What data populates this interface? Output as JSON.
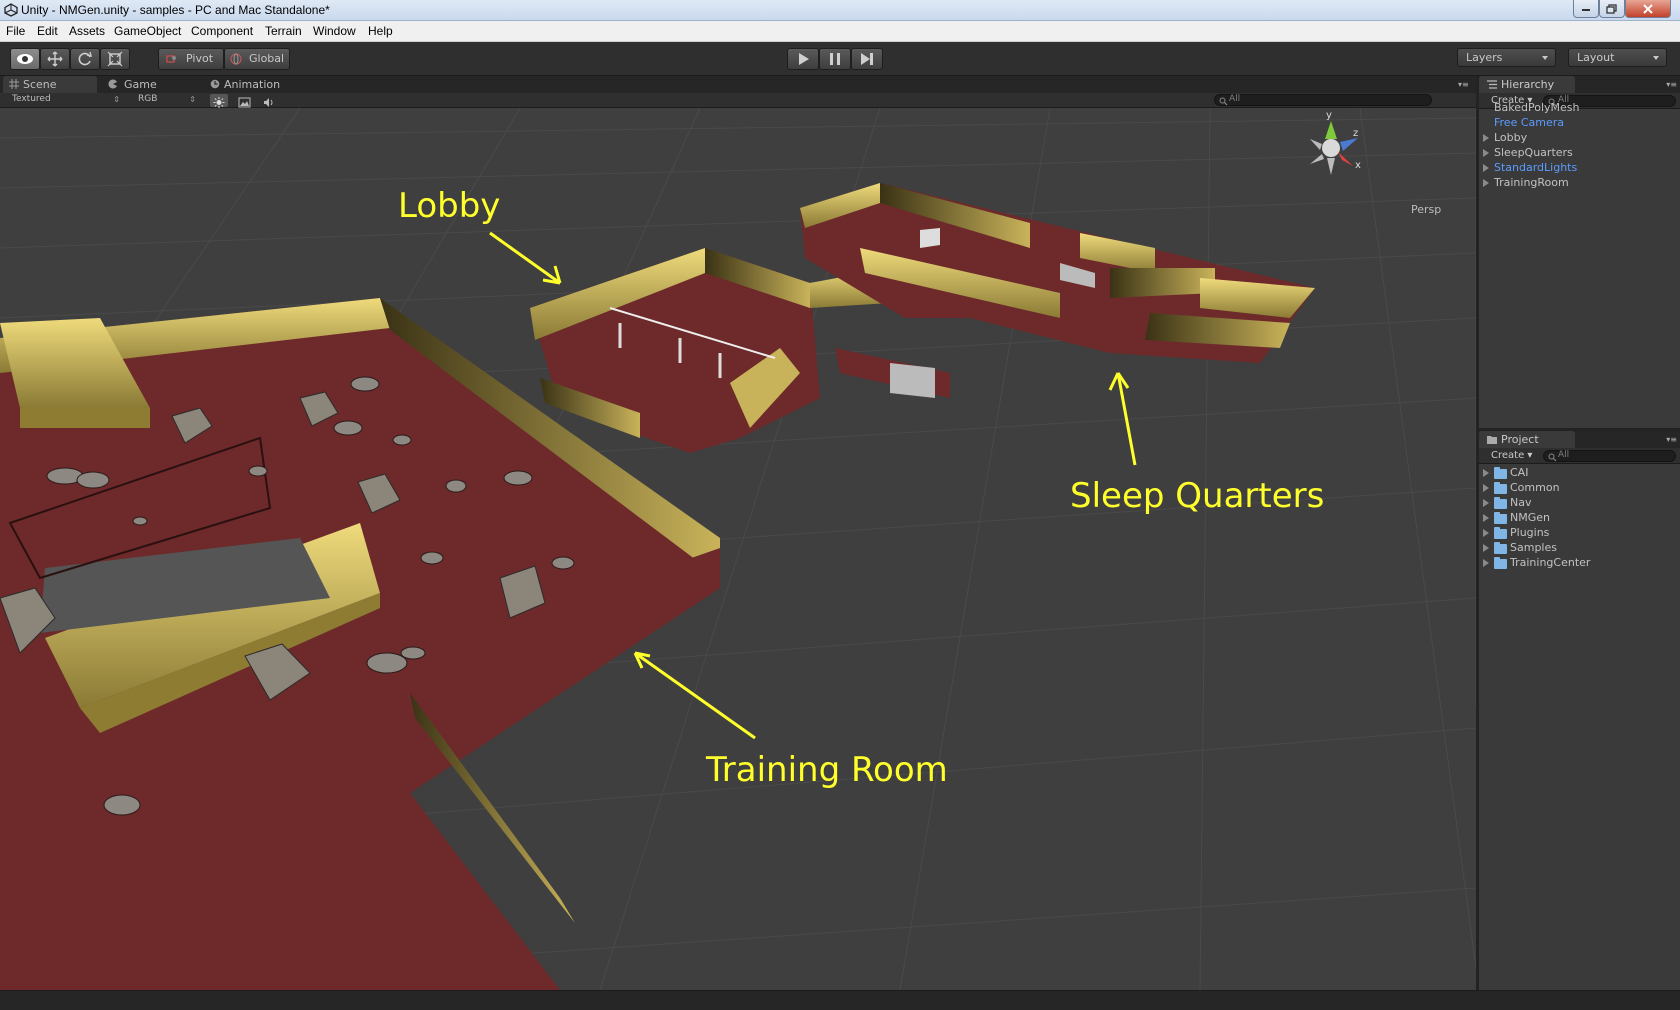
{
  "window": {
    "title": "Unity - NMGen.unity - samples - PC and Mac Standalone*"
  },
  "menu": [
    "File",
    "Edit",
    "Assets",
    "GameObject",
    "Component",
    "Terrain",
    "Window",
    "Help"
  ],
  "toolbar": {
    "pivot_label": "Pivot",
    "global_label": "Global",
    "layers_label": "Layers",
    "layout_label": "Layout"
  },
  "scene_tabs": {
    "scene": "Scene",
    "game": "Game",
    "animation": "Animation"
  },
  "scene_options": {
    "render_mode": "Textured",
    "color_mode": "RGB",
    "search_placeholder": "All"
  },
  "viewport": {
    "projection_label": "Persp",
    "gizmo_axes": {
      "x": "x",
      "y": "y",
      "z": "z"
    },
    "annotations": {
      "lobby": "Lobby",
      "sleep_quarters": "Sleep Quarters",
      "training_room": "Training Room"
    },
    "colors": {
      "annotation": "#ffff2b",
      "floor": "#6e2a2a",
      "wall": "#d7c067",
      "ground": "#3f3f3f"
    }
  },
  "hierarchy": {
    "tab_label": "Hierarchy",
    "create_label": "Create",
    "search_placeholder": "All",
    "items": [
      {
        "label": "BakedPolyMesh",
        "prefab": false,
        "expandable": false
      },
      {
        "label": "Free Camera",
        "prefab": true,
        "expandable": false
      },
      {
        "label": "Lobby",
        "prefab": false,
        "expandable": true
      },
      {
        "label": "SleepQuarters",
        "prefab": false,
        "expandable": true
      },
      {
        "label": "StandardLights",
        "prefab": true,
        "expandable": true
      },
      {
        "label": "TrainingRoom",
        "prefab": false,
        "expandable": true
      }
    ]
  },
  "project": {
    "tab_label": "Project",
    "create_label": "Create",
    "search_placeholder": "All",
    "folders": [
      "CAI",
      "Common",
      "Nav",
      "NMGen",
      "Plugins",
      "Samples",
      "TrainingCenter"
    ]
  }
}
